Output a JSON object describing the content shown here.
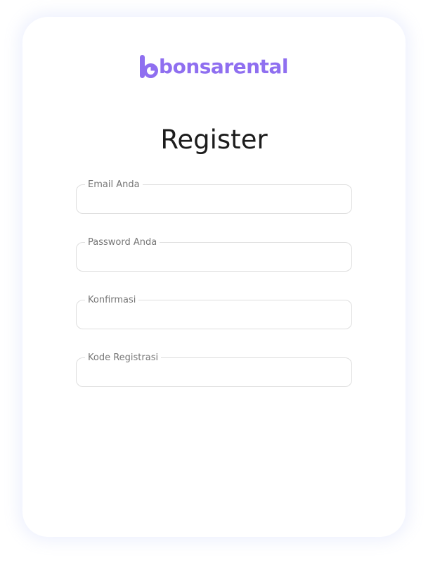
{
  "brand": {
    "name": "bonsarental",
    "color": "#8f6ff0"
  },
  "page": {
    "title": "Register"
  },
  "form": {
    "fields": [
      {
        "label": "Email Anda",
        "value": ""
      },
      {
        "label": "Password Anda",
        "value": ""
      },
      {
        "label": "Konfirmasi",
        "value": ""
      },
      {
        "label": "Kode Registrasi",
        "value": ""
      }
    ]
  }
}
